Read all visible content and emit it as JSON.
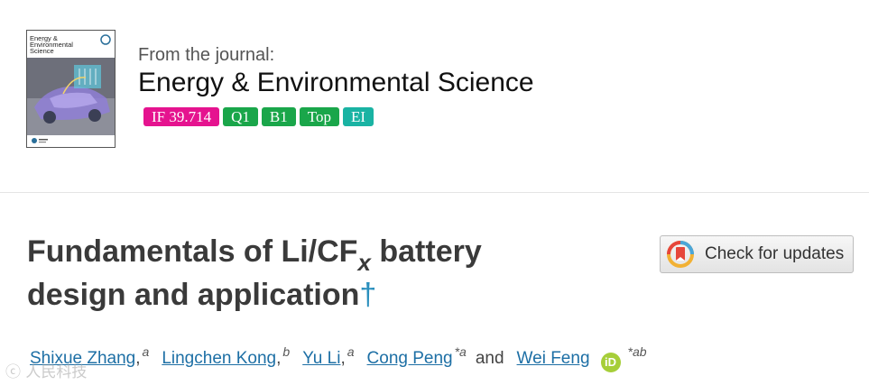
{
  "journal": {
    "from_label": "From the journal:",
    "name": "Energy & Environmental Science",
    "cover": {
      "title_lines": [
        "Energy &",
        "Environmental",
        "Science"
      ]
    },
    "badges": [
      {
        "label": "IF 39.714",
        "color": "#e5138f"
      },
      {
        "label": "Q1",
        "color": "#1aa64a"
      },
      {
        "label": "B1",
        "color": "#1aa64a"
      },
      {
        "label": "Top",
        "color": "#1aa64a"
      },
      {
        "label": "EI",
        "color": "#1ab3a3"
      }
    ]
  },
  "article": {
    "title_part1": "Fundamentals of Li/CF",
    "title_subscript": "x",
    "title_part2": " battery",
    "title_line2": "design and application",
    "title_footnote": "†",
    "check_updates_label": "Check for updates",
    "authors": [
      {
        "name": "Shixue Zhang",
        "aff": "a",
        "sep": ","
      },
      {
        "name": "Lingchen Kong",
        "aff": "b",
        "sep": ","
      },
      {
        "name": "Yu Li",
        "aff": "a",
        "sep": ","
      },
      {
        "name": "Cong Peng",
        "aff": "*a",
        "sep": ""
      },
      {
        "name": "Wei Feng",
        "aff": "*ab",
        "sep": ""
      }
    ],
    "and_text": "and",
    "orcid_label": "iD"
  },
  "watermark": "ⓒ 人民科技"
}
